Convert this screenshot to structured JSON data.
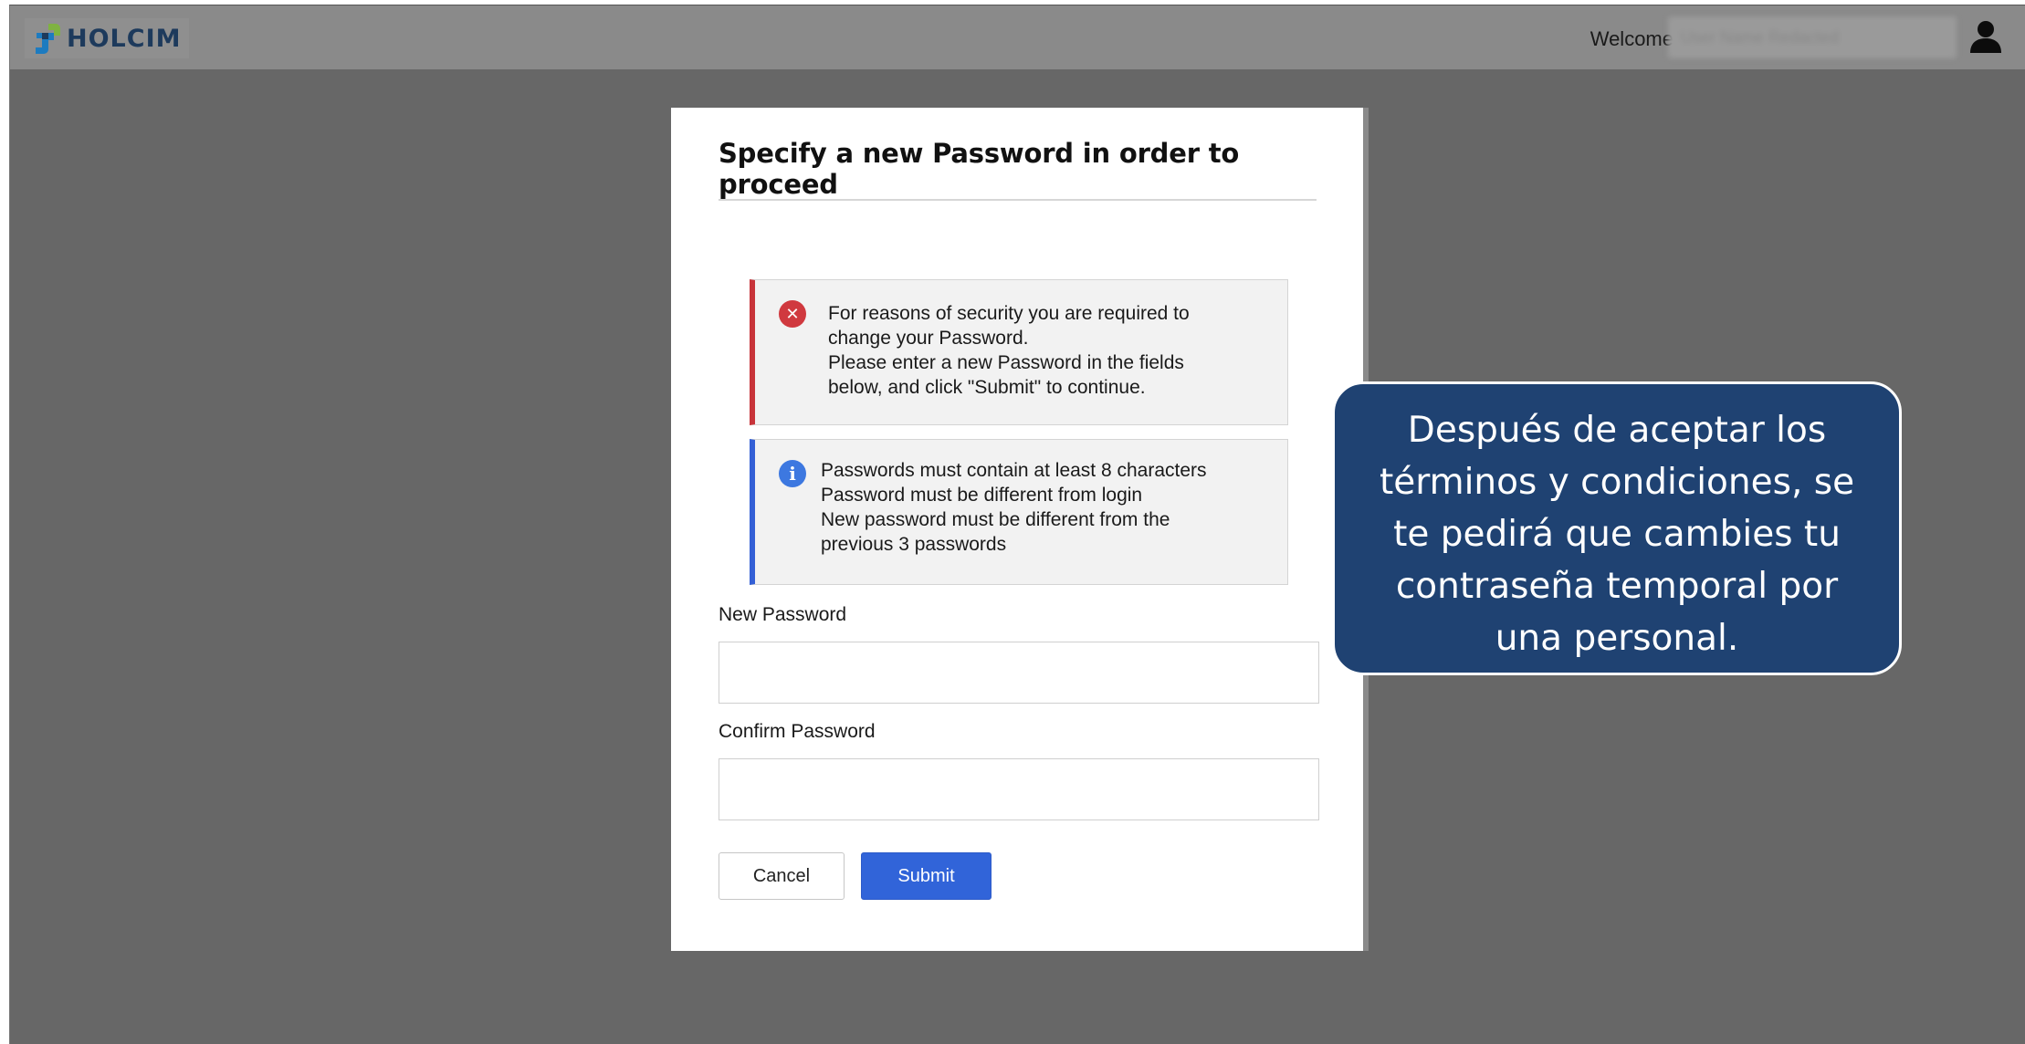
{
  "header": {
    "logo_text": "HOLCIM",
    "welcome_label": "Welcome",
    "user_name": "User Name Redacted"
  },
  "dialog": {
    "title": "Specify a new Password in order to proceed",
    "error_alert": {
      "lines": [
        "For reasons of security you are required to",
        "change your Password.",
        "Please enter a new Password in the fields",
        "below, and click \"Submit\" to continue."
      ]
    },
    "info_alert": {
      "lines": [
        "Passwords must contain at least 8 characters",
        "Password must be different from login",
        "New password must be different from the",
        "previous 3 passwords"
      ]
    },
    "new_password_label": "New Password",
    "new_password_value": "",
    "confirm_password_label": "Confirm Password",
    "confirm_password_value": "",
    "cancel_label": "Cancel",
    "submit_label": "Submit"
  },
  "callout": {
    "lines": [
      "Después de aceptar los",
      "términos y condiciones, se",
      "te pedirá que cambies tu",
      "contraseña temporal por",
      "una personal."
    ]
  },
  "colors": {
    "background": "#676767",
    "topbar": "#8a8a8a",
    "error_accent": "#c8343a",
    "info_accent": "#3460d6",
    "submit_button": "#3164d9",
    "callout_fill": "#1f4272"
  },
  "icons": {
    "error": "error-circle-icon",
    "info": "info-circle-icon",
    "user": "user-icon",
    "logo": "holcim-logo-icon"
  }
}
